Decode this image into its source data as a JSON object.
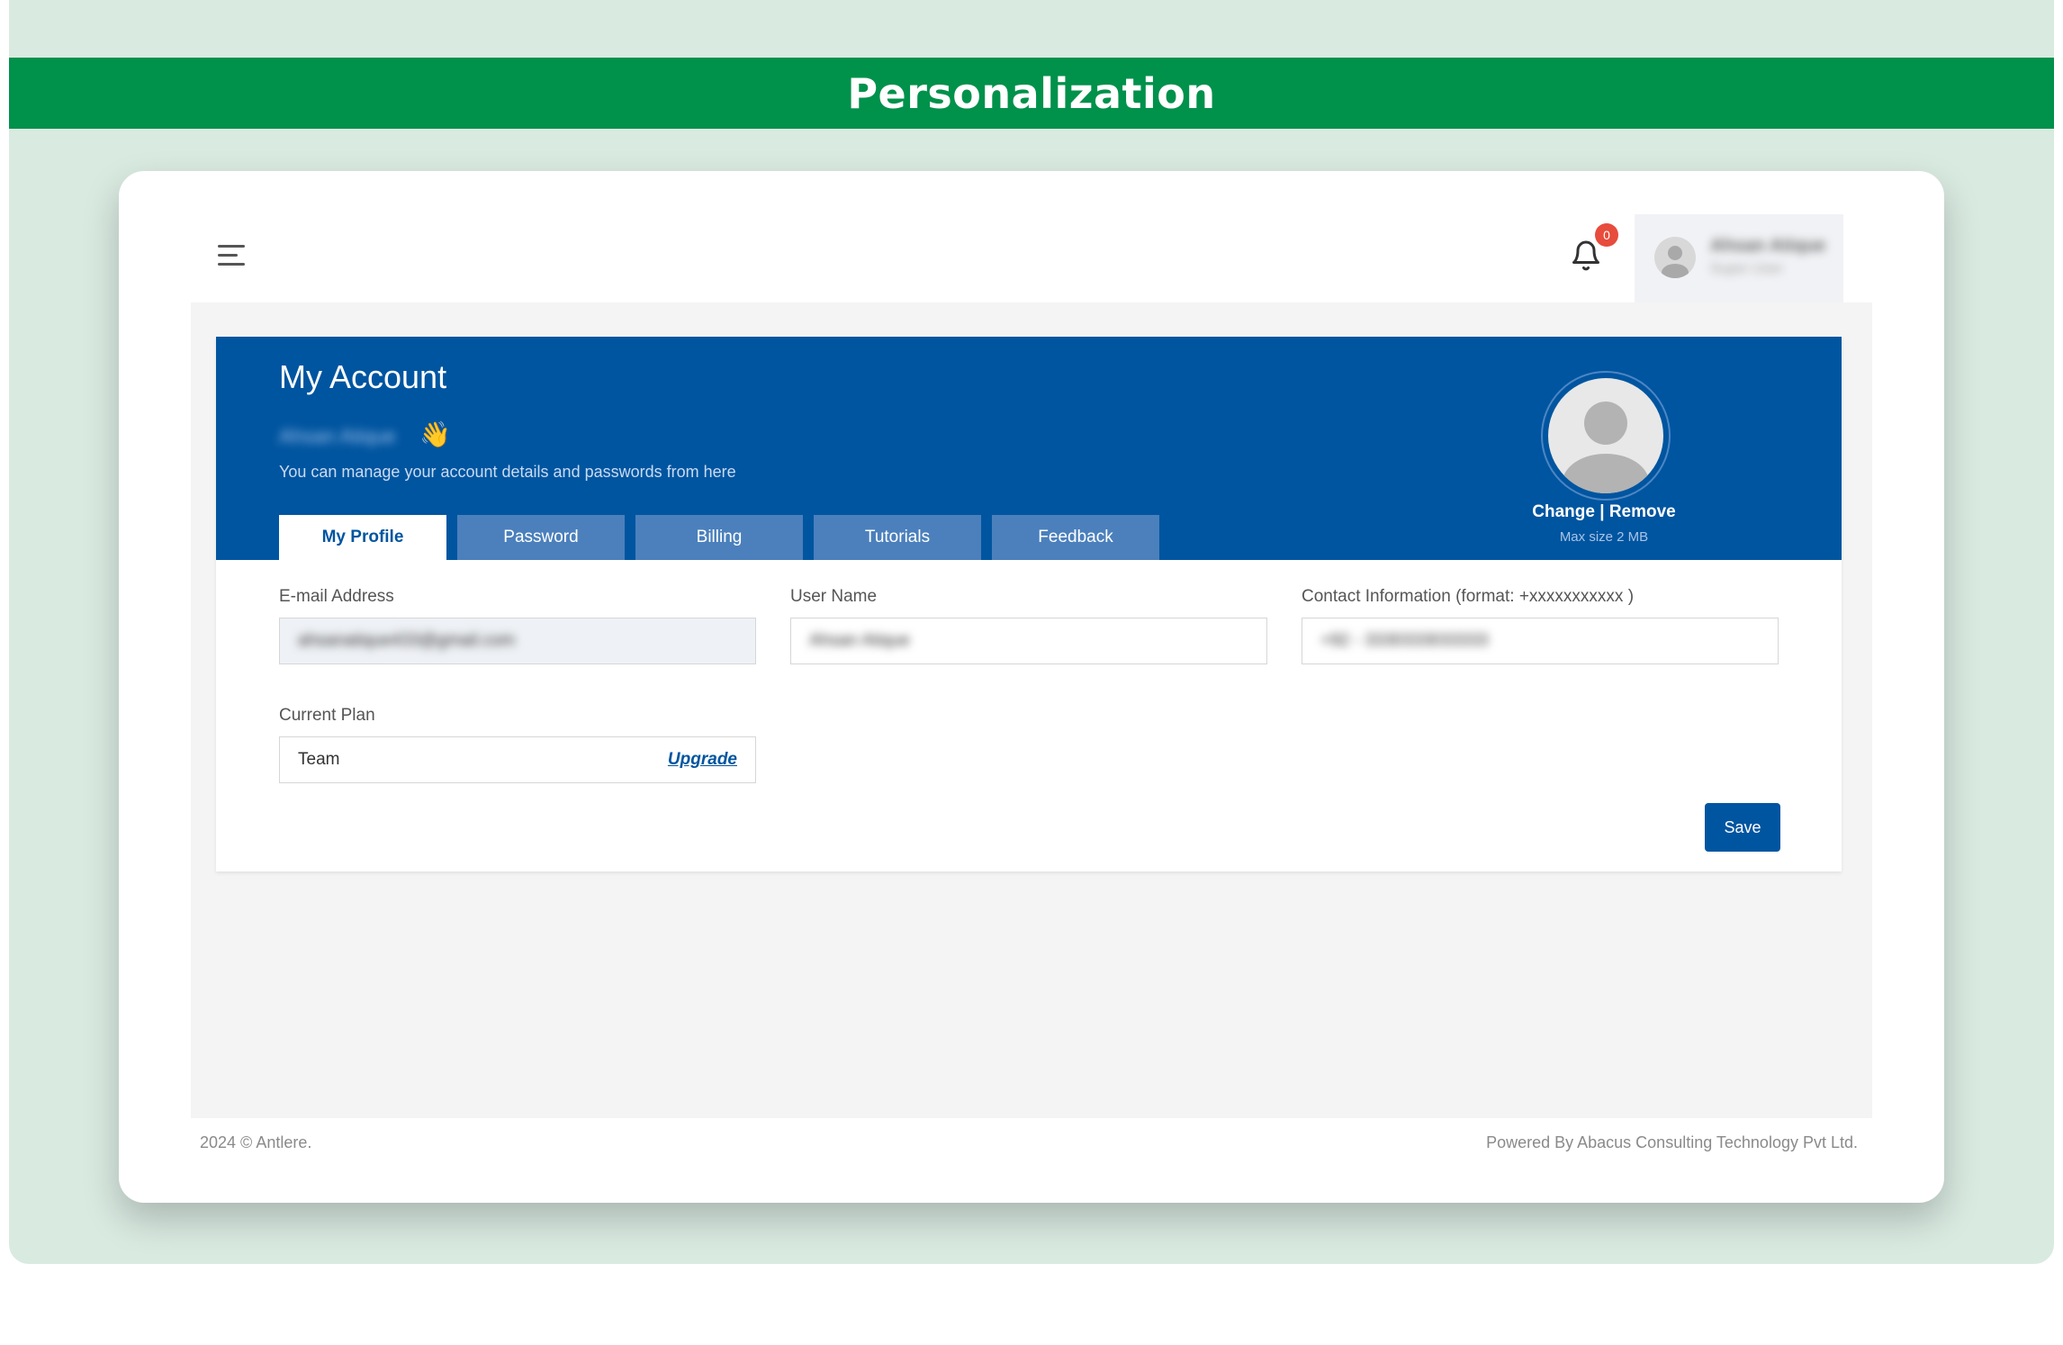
{
  "banner": {
    "title": "Personalization"
  },
  "topbar": {
    "menu_icon": "hamburger-icon",
    "notifications": {
      "icon": "bell-icon",
      "count": "0"
    },
    "user": {
      "name": "Ahsan Atique",
      "role": "Super User"
    }
  },
  "account": {
    "title": "My Account",
    "greeting_name": "Ahsan Atique",
    "greeting_emoji": "👋",
    "subtitle": "You can manage your account details and passwords from here",
    "tabs": [
      {
        "label": "My Profile",
        "active": true
      },
      {
        "label": "Password",
        "active": false
      },
      {
        "label": "Billing",
        "active": false
      },
      {
        "label": "Tutorials",
        "active": false
      },
      {
        "label": "Feedback",
        "active": false
      }
    ],
    "photo": {
      "change_label": "Change",
      "separator": " | ",
      "remove_label": "Remove",
      "note": "Max size 2 MB"
    }
  },
  "form": {
    "email": {
      "label": "E-mail Address",
      "value": "ahsanatique433@gmail.com"
    },
    "username": {
      "label": "User Name",
      "value": "Ahsan Atique"
    },
    "contact": {
      "label": "Contact Information (format: +xxxxxxxxxxx )",
      "value": "+92 - 3330333033333"
    },
    "plan": {
      "label": "Current Plan",
      "value": "Team",
      "upgrade_label": "Upgrade"
    },
    "save_label": "Save"
  },
  "footer": {
    "left": "2024 © Antlere.",
    "right": "Powered By Abacus Consulting Technology Pvt Ltd."
  },
  "colors": {
    "banner_green": "#00914b",
    "brand_blue": "#0055a0",
    "badge_red": "#e74c3c"
  }
}
